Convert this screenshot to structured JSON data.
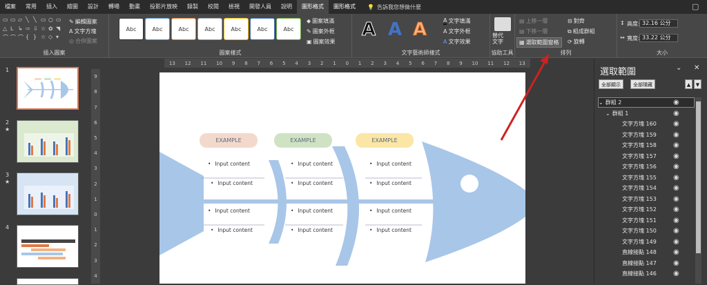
{
  "tabs": [
    "檔案",
    "常用",
    "插入",
    "繪圖",
    "設計",
    "轉場",
    "動畫",
    "投影片放映",
    "錄製",
    "校閱",
    "檢視",
    "開發人員",
    "說明",
    "圖形格式",
    "圖形格式"
  ],
  "active_tab_index": 13,
  "tell_me": "告訴我您想做什麼",
  "ribbon": {
    "insert_shapes": {
      "label": "插入圖案",
      "edit_shape": "編輯圖案",
      "text_box": "文字方塊",
      "merge_shapes": "合併圖案"
    },
    "shape_styles": {
      "label": "圖案樣式",
      "samples": [
        "Abc",
        "Abc",
        "Abc",
        "Abc",
        "Abc",
        "Abc",
        "Abc"
      ],
      "fill": "圖案填滿",
      "outline": "圖案外框",
      "effects": "圖案效果"
    },
    "wordart": {
      "label": "文字藝術師樣式",
      "letters": [
        "A",
        "A",
        "A"
      ],
      "text_fill": "文字填滿",
      "text_outline": "文字外框",
      "text_effects": "文字效果"
    },
    "accessibility": {
      "label": "協助工具",
      "alt_text": "替代\n文字"
    },
    "arrange": {
      "label": "排列",
      "bring_forward": "上移一層",
      "send_backward": "下移一層",
      "selection_pane": "選取範圍窗格",
      "align": "對齊",
      "group": "組成群組",
      "rotate": "旋轉"
    },
    "size": {
      "label": "大小",
      "height_label": "高度:",
      "height": "32.16 公分",
      "width_label": "寬度:",
      "width": "33.22 公分"
    }
  },
  "slides": [
    {
      "num": "1",
      "star": ""
    },
    {
      "num": "2",
      "star": "★"
    },
    {
      "num": "3",
      "star": "★"
    },
    {
      "num": "4",
      "star": ""
    }
  ],
  "ruler_h": [
    "13",
    "12",
    "11",
    "10",
    "9",
    "8",
    "7",
    "6",
    "5",
    "4",
    "3",
    "2",
    "1",
    "0",
    "1",
    "2",
    "3",
    "4",
    "5",
    "6",
    "7",
    "8",
    "9",
    "10",
    "11",
    "12",
    "13"
  ],
  "ruler_v": [
    "9",
    "8",
    "7",
    "6",
    "5",
    "4",
    "3",
    "2",
    "1",
    "0",
    "1",
    "2",
    "3",
    "4"
  ],
  "slide": {
    "examples": [
      "EXAMPLE",
      "EXAMPLE",
      "EXAMPLE"
    ],
    "contents": [
      "Input content",
      "Input content",
      "Input content",
      "Input content",
      "Input content",
      "Input content",
      "Input content",
      "Input content",
      "Input content",
      "Input content",
      "Input content",
      "Input content"
    ]
  },
  "selection_pane": {
    "title": "選取範圍",
    "show_all": "全部顯示",
    "hide_all": "全部隱藏",
    "items": [
      {
        "label": "群組 2",
        "level": 0,
        "expanded": true,
        "selected": true
      },
      {
        "label": "群組 1",
        "level": 1,
        "expanded": true
      },
      {
        "label": "文字方塊 160",
        "level": 2
      },
      {
        "label": "文字方塊 159",
        "level": 2
      },
      {
        "label": "文字方塊 158",
        "level": 2
      },
      {
        "label": "文字方塊 157",
        "level": 2
      },
      {
        "label": "文字方塊 156",
        "level": 2
      },
      {
        "label": "文字方塊 155",
        "level": 2
      },
      {
        "label": "文字方塊 154",
        "level": 2
      },
      {
        "label": "文字方塊 153",
        "level": 2
      },
      {
        "label": "文字方塊 152",
        "level": 2
      },
      {
        "label": "文字方塊 151",
        "level": 2
      },
      {
        "label": "文字方塊 150",
        "level": 2
      },
      {
        "label": "文字方塊 149",
        "level": 2
      },
      {
        "label": "直線接點 148",
        "level": 2
      },
      {
        "label": "直線接點 147",
        "level": 2
      },
      {
        "label": "直線接點 146",
        "level": 2
      }
    ]
  },
  "colors": {
    "fish": "#a8c6e8",
    "ex1": "#f3d9cc",
    "ex2": "#cfe3c4",
    "ex3": "#fbe6a6",
    "arrow": "#cc2222",
    "accent": "#d67a56"
  }
}
